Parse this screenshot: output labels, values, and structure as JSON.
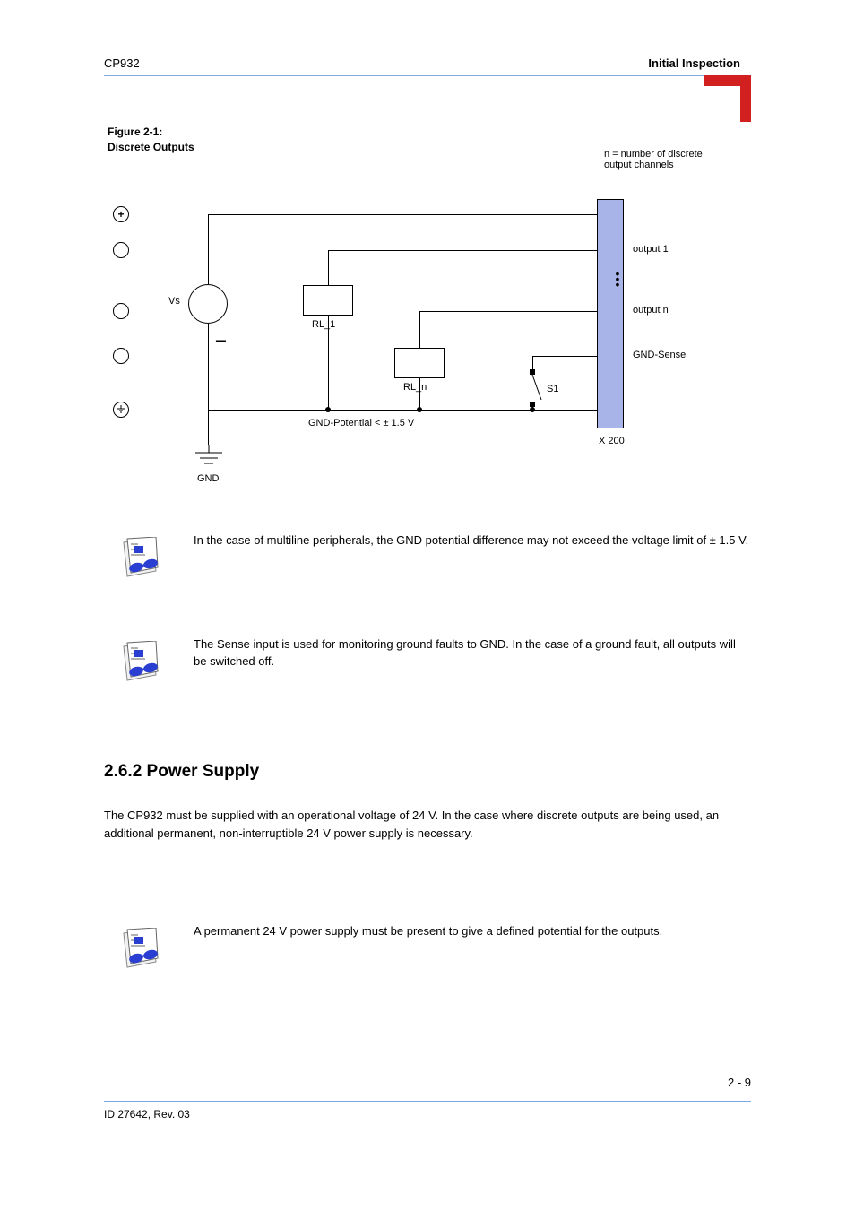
{
  "header": {
    "left": "CP932",
    "right": "Initial Inspection"
  },
  "figure": {
    "title_line1": "Figure 2-1:",
    "title_line2": "Discrete Outputs",
    "pin_meaning": "n = number of discrete output channels",
    "pin1_symbol": "+",
    "pin2_label": "output 1",
    "dots": "• • •",
    "pin_n_label": "output n",
    "pin_gnd_sense_label": "GND-Sense",
    "vs_label": "Vs",
    "minus": "−",
    "rl1": "RL_1",
    "rln": "RL_n",
    "s1": "S1",
    "gnd": "GND",
    "conn_label": "X 200"
  },
  "notes": {
    "note1": "In the case of multiline peripherals, the GND potential difference may not exceed the voltage limit of ± 1.5 V.",
    "note2": "The Sense input is used for monitoring ground faults to GND. In the case of a ground fault, all outputs will be switched off.",
    "sect_title": "2.6.2  Power Supply",
    "sect_body": "The CP932 must be supplied with an operational voltage of 24 V. In the case where discrete outputs are being used, an additional permanent, non-interruptible 24 V power supply is necessary.",
    "note3": "A permanent 24 V power supply must be present to give a defined potential for the outputs."
  },
  "footer": {
    "id": "ID 27642, Rev. 03",
    "page": "2 - 9"
  }
}
